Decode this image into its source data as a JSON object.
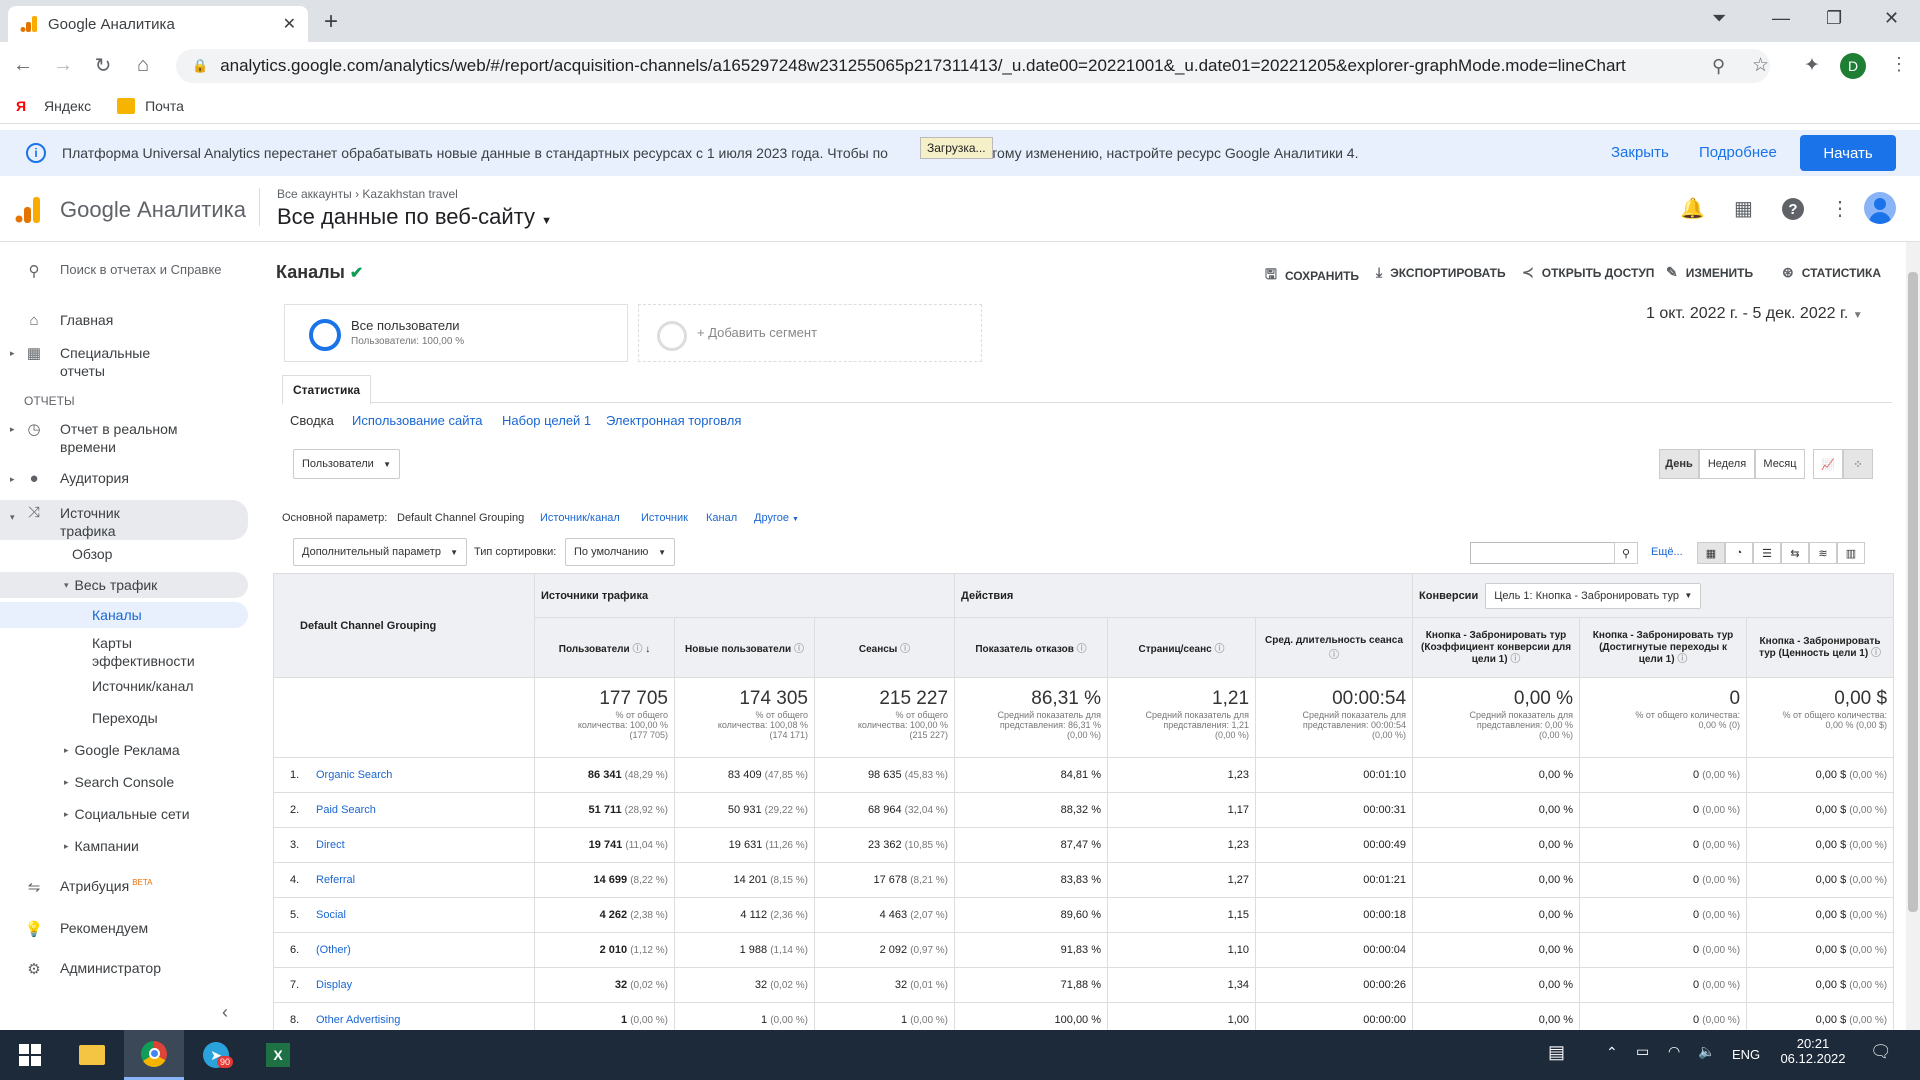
{
  "browser": {
    "tab_title": "Google Аналитика",
    "url": "analytics.google.com/analytics/web/#/report/acquisition-channels/a165297248w231255065p217311413/_u.date00=20221001&_u.date01=20221205&explorer-graphMode.mode=lineChart",
    "bookmarks": [
      "Яндекс",
      "Почта"
    ],
    "profile_initial": "D"
  },
  "banner": {
    "text_before": "Платформа Universal Analytics перестанет обрабатывать новые данные в стандартных ресурсах с 1 июля 2023 года. Чтобы по",
    "text_after": "к этому изменению, настройте ресурс Google Аналитики 4.",
    "loading": "Загрузка...",
    "close": "Закрыть",
    "more": "Подробнее",
    "start": "Начать"
  },
  "header": {
    "brand": "Google Аналитика",
    "crumb_all": "Все аккаунты",
    "crumb_account": "Kazakhstan travel",
    "view": "Все данные по веб-сайту"
  },
  "sidebar": {
    "search": "Поиск в отчетах и Справке",
    "home": "Главная",
    "custom": "Специальные отчеты",
    "reports_heading": "ОТЧЕТЫ",
    "realtime": "Отчет в реальном времени",
    "audience": "Аудитория",
    "acquisition": "Источник трафика",
    "overview": "Обзор",
    "all_traffic": "Весь трафик",
    "channels": "Каналы",
    "treemaps": "Карты эффективности",
    "source_medium": "Источник/канал",
    "referrals": "Переходы",
    "google_ads": "Google Реклама",
    "search_console": "Search Console",
    "social": "Социальные сети",
    "campaigns": "Кампании",
    "attribution": "Атрибуция",
    "beta": "BETA",
    "discover": "Рекомендуем",
    "admin": "Администратор"
  },
  "report": {
    "title": "Каналы",
    "actions": [
      "СОХРАНИТЬ",
      "ЭКСПОРТИРОВАТЬ",
      "ОТКРЫТЬ ДОСТУП",
      "ИЗМЕНИТЬ",
      "СТАТИСТИКА"
    ],
    "segment_name": "Все пользователи",
    "segment_sub": "Пользователи: 100,00 %",
    "add_segment": "+ Добавить сегмент",
    "date_range": "1 окт. 2022 г. - 5 дек. 2022 г.",
    "tab": "Статистика",
    "subtabs": [
      "Сводка",
      "Использование сайта",
      "Набор целей 1",
      "Электронная торговля"
    ],
    "metric_select": "Пользователи",
    "period_buttons": [
      "День",
      "Неделя",
      "Месяц"
    ],
    "primary_dim_label": "Основной параметр:",
    "primary_dim": "Default Channel Grouping",
    "dims": [
      "Источник/канал",
      "Источник",
      "Канал",
      "Другое"
    ],
    "secondary_dim": "Дополнительный параметр",
    "sort_label": "Тип сортировки:",
    "sort_value": "По умолчанию",
    "more": "Ещё..."
  },
  "table": {
    "dim_header": "Default Channel Grouping",
    "group_acq": "Источники трафика",
    "group_beh": "Действия",
    "group_conv": "Конверсии",
    "goal_select": "Цель 1: Кнопка - Забронировать тур",
    "columns": [
      "Пользователи",
      "Новые пользователи",
      "Сеансы",
      "Показатель отказов",
      "Страниц/сеанс",
      "Сред. длительность сеанса",
      "Кнопка - Забронировать тур (Коэффициент конверсии для цели 1)",
      "Кнопка - Забронировать тур (Достигнутые переходы к цели 1)",
      "Кнопка - Забронировать тур (Ценность цели 1)"
    ],
    "totals": [
      {
        "v": "177 705",
        "s1": "% от общего",
        "s2": "количества: 100,00 %",
        "s3": "(177 705)"
      },
      {
        "v": "174 305",
        "s1": "% от общего",
        "s2": "количества: 100,08 %",
        "s3": "(174 171)"
      },
      {
        "v": "215 227",
        "s1": "% от общего",
        "s2": "количества: 100,00 %",
        "s3": "(215 227)"
      },
      {
        "v": "86,31 %",
        "s1": "Средний показатель для",
        "s2": "представления: 86,31 %",
        "s3": "(0,00 %)"
      },
      {
        "v": "1,21",
        "s1": "Средний показатель для",
        "s2": "представления: 1,21",
        "s3": "(0,00 %)"
      },
      {
        "v": "00:00:54",
        "s1": "Средний показатель для",
        "s2": "представления: 00:00:54",
        "s3": "(0,00 %)"
      },
      {
        "v": "0,00 %",
        "s1": "Средний показатель для",
        "s2": "представления: 0,00 %",
        "s3": "(0,00 %)"
      },
      {
        "v": "0",
        "s1": "% от общего количества:",
        "s2": "0,00 % (0)",
        "s3": ""
      },
      {
        "v": "0,00 $",
        "s1": "% от общего количества:",
        "s2": "0,00 % (0,00 $)",
        "s3": ""
      }
    ],
    "rows": [
      {
        "n": "1.",
        "name": "Organic Search",
        "u": "86 341",
        "up": "(48,29 %)",
        "nu": "83 409",
        "nup": "(47,85 %)",
        "s": "98 635",
        "sp": "(45,83 %)",
        "br": "84,81 %",
        "pps": "1,23",
        "dur": "00:01:10",
        "cr": "0,00 %",
        "gc": "0",
        "gcp": "(0,00 %)",
        "gv": "0,00 $",
        "gvp": "(0,00 %)"
      },
      {
        "n": "2.",
        "name": "Paid Search",
        "u": "51 711",
        "up": "(28,92 %)",
        "nu": "50 931",
        "nup": "(29,22 %)",
        "s": "68 964",
        "sp": "(32,04 %)",
        "br": "88,32 %",
        "pps": "1,17",
        "dur": "00:00:31",
        "cr": "0,00 %",
        "gc": "0",
        "gcp": "(0,00 %)",
        "gv": "0,00 $",
        "gvp": "(0,00 %)"
      },
      {
        "n": "3.",
        "name": "Direct",
        "u": "19 741",
        "up": "(11,04 %)",
        "nu": "19 631",
        "nup": "(11,26 %)",
        "s": "23 362",
        "sp": "(10,85 %)",
        "br": "87,47 %",
        "pps": "1,23",
        "dur": "00:00:49",
        "cr": "0,00 %",
        "gc": "0",
        "gcp": "(0,00 %)",
        "gv": "0,00 $",
        "gvp": "(0,00 %)"
      },
      {
        "n": "4.",
        "name": "Referral",
        "u": "14 699",
        "up": "(8,22 %)",
        "nu": "14 201",
        "nup": "(8,15 %)",
        "s": "17 678",
        "sp": "(8,21 %)",
        "br": "83,83 %",
        "pps": "1,27",
        "dur": "00:01:21",
        "cr": "0,00 %",
        "gc": "0",
        "gcp": "(0,00 %)",
        "gv": "0,00 $",
        "gvp": "(0,00 %)"
      },
      {
        "n": "5.",
        "name": "Social",
        "u": "4 262",
        "up": "(2,38 %)",
        "nu": "4 112",
        "nup": "(2,36 %)",
        "s": "4 463",
        "sp": "(2,07 %)",
        "br": "89,60 %",
        "pps": "1,15",
        "dur": "00:00:18",
        "cr": "0,00 %",
        "gc": "0",
        "gcp": "(0,00 %)",
        "gv": "0,00 $",
        "gvp": "(0,00 %)"
      },
      {
        "n": "6.",
        "name": "(Other)",
        "u": "2 010",
        "up": "(1,12 %)",
        "nu": "1 988",
        "nup": "(1,14 %)",
        "s": "2 092",
        "sp": "(0,97 %)",
        "br": "91,83 %",
        "pps": "1,10",
        "dur": "00:00:04",
        "cr": "0,00 %",
        "gc": "0",
        "gcp": "(0,00 %)",
        "gv": "0,00 $",
        "gvp": "(0,00 %)"
      },
      {
        "n": "7.",
        "name": "Display",
        "u": "32",
        "up": "(0,02 %)",
        "nu": "32",
        "nup": "(0,02 %)",
        "s": "32",
        "sp": "(0,01 %)",
        "br": "71,88 %",
        "pps": "1,34",
        "dur": "00:00:26",
        "cr": "0,00 %",
        "gc": "0",
        "gcp": "(0,00 %)",
        "gv": "0,00 $",
        "gvp": "(0,00 %)"
      },
      {
        "n": "8.",
        "name": "Other Advertising",
        "u": "1",
        "up": "(0,00 %)",
        "nu": "1",
        "nup": "(0,00 %)",
        "s": "1",
        "sp": "(0,00 %)",
        "br": "100,00 %",
        "pps": "1,00",
        "dur": "00:00:00",
        "cr": "0,00 %",
        "gc": "0",
        "gcp": "(0,00 %)",
        "gv": "0,00 $",
        "gvp": "(0,00 %)"
      }
    ]
  },
  "taskbar": {
    "telegram_badge": "90",
    "lang": "ENG",
    "time": "20:21",
    "date": "06.12.2022"
  }
}
